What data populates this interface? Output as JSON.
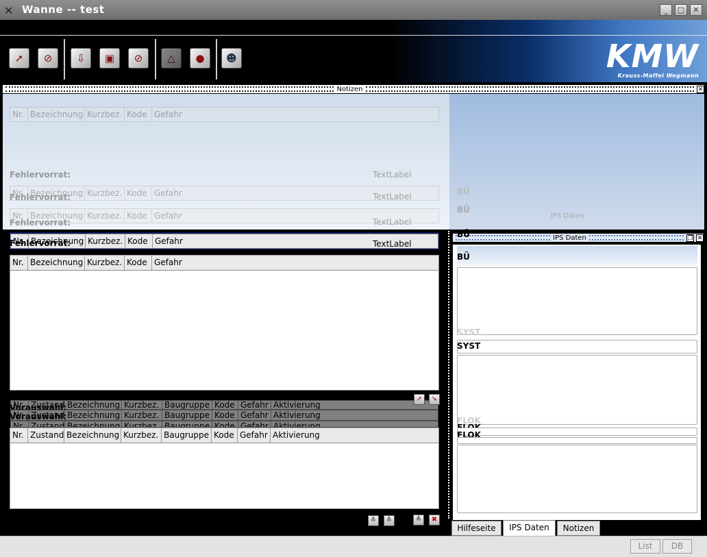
{
  "window": {
    "title": "Wanne -- test"
  },
  "banner": {
    "logo_text": "KMW",
    "logo_subtitle": "Krauss-Maffei Wegmann"
  },
  "toolbar": {
    "icons": [
      "export-icon",
      "no-entry-icon",
      "import-icon",
      "delete-doc-icon",
      "no-edit-icon",
      "warning-triangle-icon",
      "record-icon",
      "user-icon"
    ]
  },
  "docks": {
    "notizen": "Notizen",
    "ips": "IPS Daten"
  },
  "left": {
    "fehler_label": "Fehlervorrat:",
    "text_label": "TextLabel",
    "top_columns": [
      "Nr.",
      "Bezeichnung",
      "Kurzbez.",
      "Kode",
      "Gefahr"
    ],
    "vorauswahl_label": "Vorauswahl:",
    "bottom_columns": [
      "Nr.",
      "Zustand",
      "Bezeichnung",
      "Kurzbez.",
      "Baugruppe",
      "Kode",
      "Gefahr",
      "Aktivierung"
    ]
  },
  "right": {
    "bu_label": "BÜ",
    "syst_label": "SYST",
    "flok_label": "FLOK"
  },
  "tabs": [
    "Hilfeseite",
    "IPS Daten",
    "Notizen"
  ],
  "active_tab": "IPS Daten",
  "statusbar": {
    "list_label": "List",
    "db_label": "DB"
  }
}
